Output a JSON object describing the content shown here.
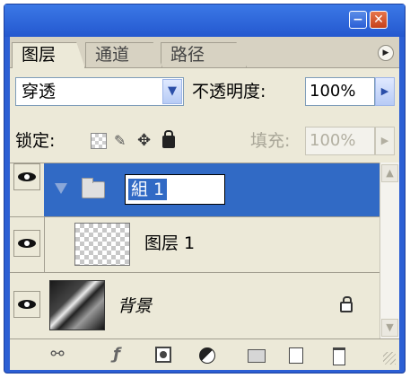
{
  "window": {
    "minimize_icon": "minimize-icon",
    "close_icon": "close-icon",
    "minimize_glyph": "−",
    "close_glyph": "✕"
  },
  "tabs": [
    {
      "label": "图层",
      "active": true
    },
    {
      "label": "通道",
      "active": false
    },
    {
      "label": "路径",
      "active": false
    }
  ],
  "panel_menu_icon": "▶",
  "blend_mode": {
    "value": "穿透",
    "arrow": "▼"
  },
  "opacity": {
    "label": "不透明度:",
    "value": "100%",
    "arrow": "▶"
  },
  "lock": {
    "label": "锁定:",
    "icons": [
      "lock-transparent-icon",
      "lock-pixels-icon",
      "lock-position-icon",
      "lock-all-icon"
    ],
    "position_glyph": "✥",
    "pixels_glyph": "✎"
  },
  "fill": {
    "label": "填充:",
    "value": "100%",
    "arrow": "▶"
  },
  "layers": [
    {
      "name": "組 1",
      "type": "group",
      "selected": true,
      "editing": true
    },
    {
      "name": "图层 1",
      "type": "layer",
      "selected": false
    },
    {
      "name": "背景",
      "type": "background",
      "locked": true
    }
  ],
  "scrollbar": {
    "up": "▲",
    "down": "▼"
  },
  "toolbar": {
    "link_glyph": "⚯",
    "fx_glyph": "ƒ",
    "icons": [
      "link-layers-icon",
      "layer-style-icon",
      "layer-mask-icon",
      "adjustment-layer-icon",
      "new-group-icon",
      "new-layer-icon",
      "delete-layer-icon"
    ]
  },
  "colors": {
    "selection": "#316ac5",
    "titlebar": "#2c5fd4",
    "panel": "#ece9d8"
  }
}
